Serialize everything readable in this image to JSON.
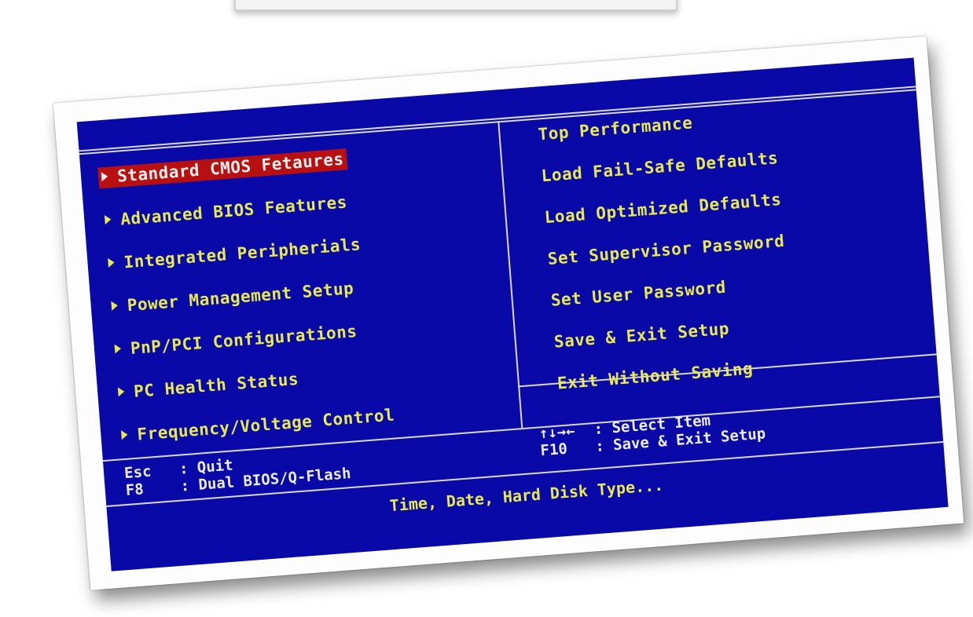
{
  "bios": {
    "left_menu": [
      {
        "label": "Standard CMOS Fetaures",
        "selected": true
      },
      {
        "label": "Advanced BIOS Features",
        "selected": false
      },
      {
        "label": "Integrated Peripherials",
        "selected": false
      },
      {
        "label": "Power Management Setup",
        "selected": false
      },
      {
        "label": "PnP/PCI Configurations",
        "selected": false
      },
      {
        "label": "PC Health Status",
        "selected": false
      },
      {
        "label": "Frequency/Voltage Control",
        "selected": false
      }
    ],
    "right_menu": [
      {
        "label": "Top Performance"
      },
      {
        "label": "Load Fail-Safe Defaults"
      },
      {
        "label": "Load Optimized Defaults"
      },
      {
        "label": "Set Supervisor Password"
      },
      {
        "label": "Set User Password"
      },
      {
        "label": "Save & Exit Setup"
      },
      {
        "label": "Exit Without Saving"
      }
    ],
    "keys_left": [
      {
        "key": "Esc",
        "action": ": Quit"
      },
      {
        "key": "F8",
        "action": ": Dual BIOS/Q-Flash"
      }
    ],
    "keys_right": [
      {
        "key": "↑↓→←",
        "action": ": Select Item"
      },
      {
        "key": "F10",
        "action": ": Save & Exit Setup"
      }
    ],
    "help_text": "Time, Date, Hard Disk Type...",
    "colors": {
      "background": "#0909a8",
      "text": "#e8e850",
      "highlight": "#b81010",
      "border": "#d8d8d8"
    }
  }
}
